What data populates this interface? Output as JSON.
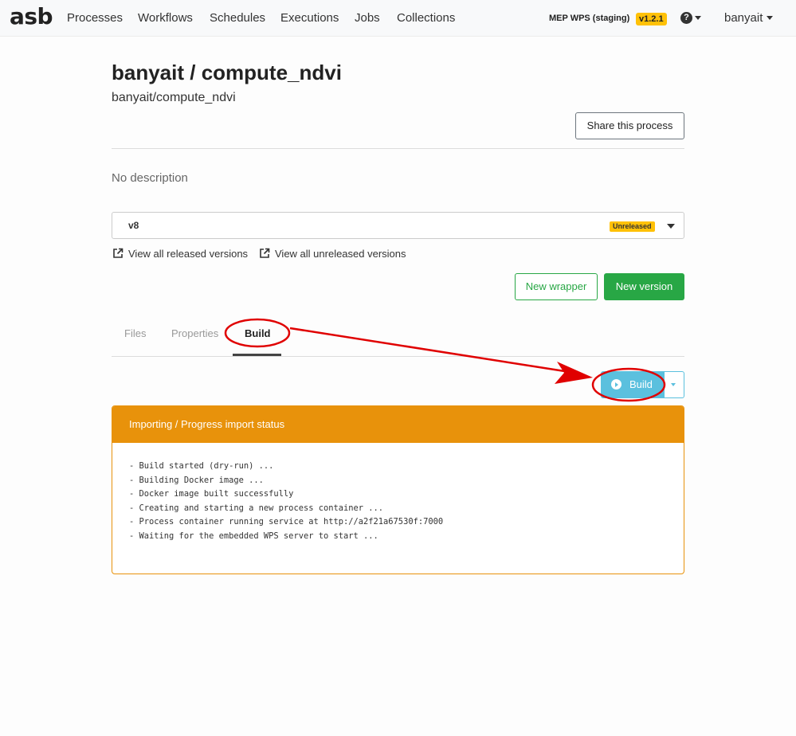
{
  "navbar": {
    "brand": "asb",
    "items": [
      "Processes",
      "Workflows",
      "Schedules",
      "Executions",
      "Jobs",
      "Collections"
    ],
    "environment": "MEP WPS (staging)",
    "version": "v1.2.1",
    "help_icon": "question-circle-icon",
    "user": "banyait"
  },
  "page": {
    "title": "banyait / compute_ndvi",
    "subtitle": "banyait/compute_ndvi",
    "share_label": "Share this process",
    "description": "No description"
  },
  "version_select": {
    "value": "v8",
    "badge": "Unreleased",
    "link_released": "View all released versions",
    "link_unreleased": "View all unreleased versions"
  },
  "actions": {
    "new_wrapper": "New wrapper",
    "new_version": "New version"
  },
  "tabs": [
    {
      "label": "Files",
      "active": false
    },
    {
      "label": "Properties",
      "active": false
    },
    {
      "label": "Build",
      "active": true
    }
  ],
  "build": {
    "button_label": "Build",
    "card_title": "Importing / Progress import status",
    "log_lines": [
      "- Build started (dry-run) ...",
      "- Building Docker image ...",
      "- Docker image built successfully",
      "- Creating and starting a new process container ...",
      "- Process container running service at http://a2f21a67530f:7000",
      "- Waiting for the embedded WPS server to start ..."
    ]
  },
  "colors": {
    "success": "#28a745",
    "info": "#5bc0de",
    "warning": "#ffc107",
    "card_header": "#e8920b",
    "annotation": "#e00000"
  }
}
